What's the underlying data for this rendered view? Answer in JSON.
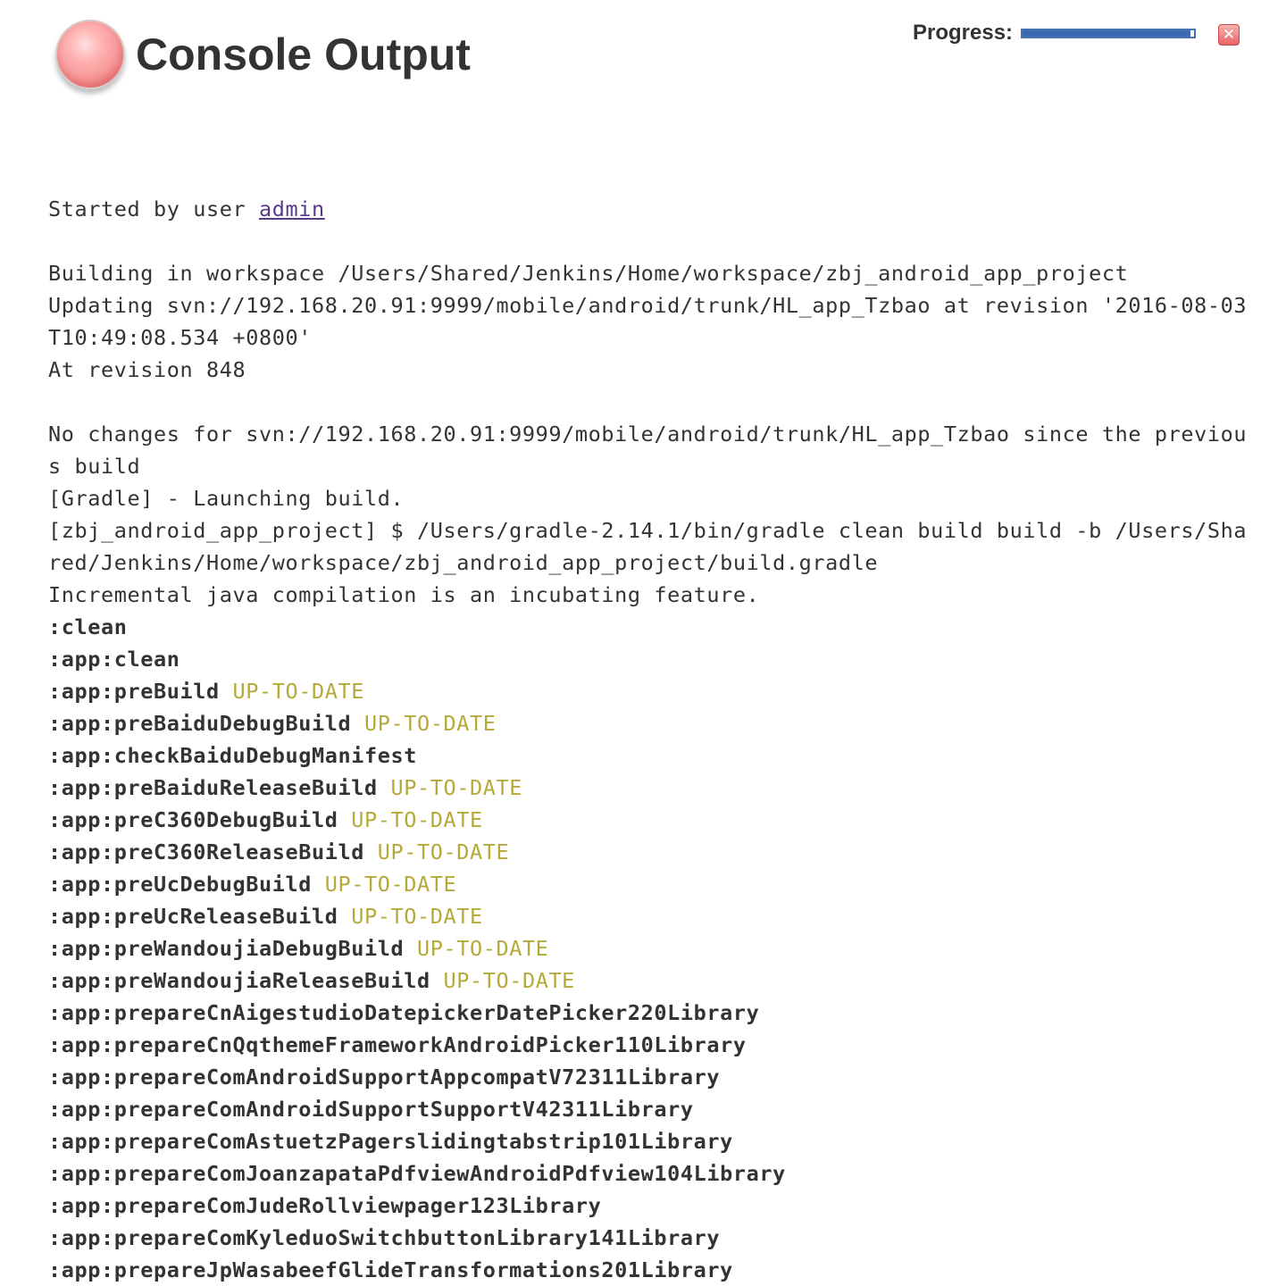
{
  "header": {
    "title": "Console Output",
    "status_icon": "red-ball-icon",
    "status_color": "#f7a0a0"
  },
  "progress": {
    "label": "Progress:",
    "fraction": 0.98,
    "bar_color": "#3c6ab2",
    "stop_icon": "close-icon",
    "stop_symbol": "✕"
  },
  "console": {
    "started_prefix": "Started by user ",
    "user": "admin",
    "lines": [
      "Building in workspace /Users/Shared/Jenkins/Home/workspace/zbj_android_app_project",
      "Updating svn://192.168.20.91:9999/mobile/android/trunk/HL_app_Tzbao at revision '2016-08-03T10:49:08.534 +0800'",
      "At revision 848",
      "",
      "No changes for svn://192.168.20.91:9999/mobile/android/trunk/HL_app_Tzbao since the previous build",
      "[Gradle] - Launching build.",
      "[zbj_android_app_project] $ /Users/gradle-2.14.1/bin/gradle clean build build -b /Users/Shared/Jenkins/Home/workspace/zbj_android_app_project/build.gradle",
      "Incremental java compilation is an incubating feature."
    ],
    "tasks": [
      {
        "name": ":clean",
        "status": ""
      },
      {
        "name": ":app:clean",
        "status": ""
      },
      {
        "name": ":app:preBuild",
        "status": "UP-TO-DATE"
      },
      {
        "name": ":app:preBaiduDebugBuild",
        "status": "UP-TO-DATE"
      },
      {
        "name": ":app:checkBaiduDebugManifest",
        "status": ""
      },
      {
        "name": ":app:preBaiduReleaseBuild",
        "status": "UP-TO-DATE"
      },
      {
        "name": ":app:preC360DebugBuild",
        "status": "UP-TO-DATE"
      },
      {
        "name": ":app:preC360ReleaseBuild",
        "status": "UP-TO-DATE"
      },
      {
        "name": ":app:preUcDebugBuild",
        "status": "UP-TO-DATE"
      },
      {
        "name": ":app:preUcReleaseBuild",
        "status": "UP-TO-DATE"
      },
      {
        "name": ":app:preWandoujiaDebugBuild",
        "status": "UP-TO-DATE"
      },
      {
        "name": ":app:preWandoujiaReleaseBuild",
        "status": "UP-TO-DATE"
      },
      {
        "name": ":app:prepareCnAigestudioDatepickerDatePicker220Library",
        "status": ""
      },
      {
        "name": ":app:prepareCnQqthemeFrameworkAndroidPicker110Library",
        "status": ""
      },
      {
        "name": ":app:prepareComAndroidSupportAppcompatV72311Library",
        "status": ""
      },
      {
        "name": ":app:prepareComAndroidSupportSupportV42311Library",
        "status": ""
      },
      {
        "name": ":app:prepareComAstuetzPagerslidingtabstrip101Library",
        "status": ""
      },
      {
        "name": ":app:prepareComJoanzapataPdfviewAndroidPdfview104Library",
        "status": ""
      },
      {
        "name": ":app:prepareComJudeRollviewpager123Library",
        "status": ""
      },
      {
        "name": ":app:prepareComKyleduoSwitchbuttonLibrary141Library",
        "status": ""
      },
      {
        "name": ":app:prepareJpWasabeefGlideTransformations201Library",
        "status": ""
      }
    ]
  }
}
